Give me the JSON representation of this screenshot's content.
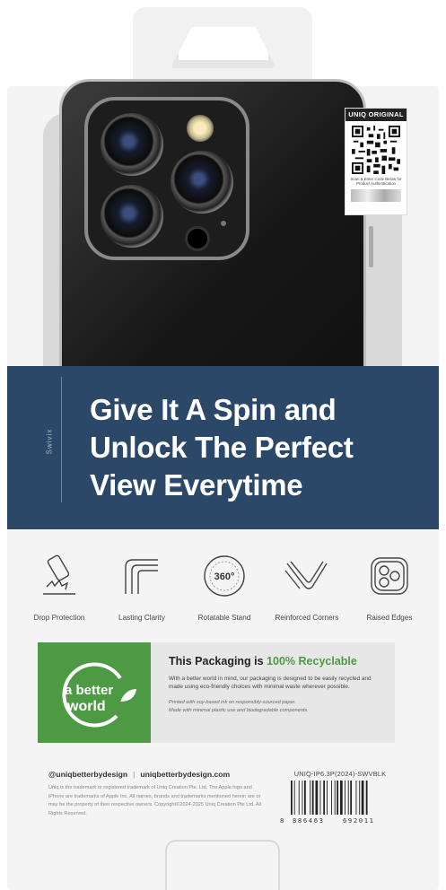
{
  "qr": {
    "brand": "UNIQ ORIGINAL",
    "caption": "Scan & Enter Code Below for Product Authentication"
  },
  "band": {
    "subtitle": "Swivix",
    "headline": [
      "Give It A Spin and",
      "Unlock The Perfect",
      "View Everytime"
    ],
    "color": "#2b4869"
  },
  "features": [
    {
      "icon": "drop-protection-icon",
      "label": "Drop Protection"
    },
    {
      "icon": "lasting-clarity-icon",
      "label": "Lasting Clarity"
    },
    {
      "icon": "rotatable-stand-icon",
      "label": "Rotatable Stand",
      "badge": "360°"
    },
    {
      "icon": "reinforced-corners-icon",
      "label": "Reinforced Corners"
    },
    {
      "icon": "raised-edges-icon",
      "label": "Raised Edges"
    }
  ],
  "recycle": {
    "logo_line1": "a better",
    "logo_line2": "world",
    "title_prefix": "This Packaging is ",
    "title_accent": "100% Recyclable",
    "body": "With a better world in mind, our packaging is designed to be easily recycled and made using eco-friendly choices with minimal waste wherever possible.",
    "note_line1": "Printed with soy-based ink on responsibly-sourced paper.",
    "note_line2": "Made with minimal plastic use and biodegradable components.",
    "accent_color": "#4e9a44"
  },
  "footer": {
    "social": "@uniqbetterbydesign",
    "separator": "|",
    "website": "uniqbetterbydesign.com",
    "legal": "Uniq is the trademark or registered trademark of Uniq Creation Pte. Ltd. The Apple logo and iPhone are trademarks of Apple Inc. All names, brands and trademarks mentioned herein are or may be the property of their respective owners. Copyright©2024-2025 Uniq Creation Pte Ltd. All Rights Reserved.",
    "sku": "UNIQ-IP6.3P(2024)-SWVBLK",
    "barcode_digits": [
      "8",
      "886463",
      "692011"
    ]
  }
}
